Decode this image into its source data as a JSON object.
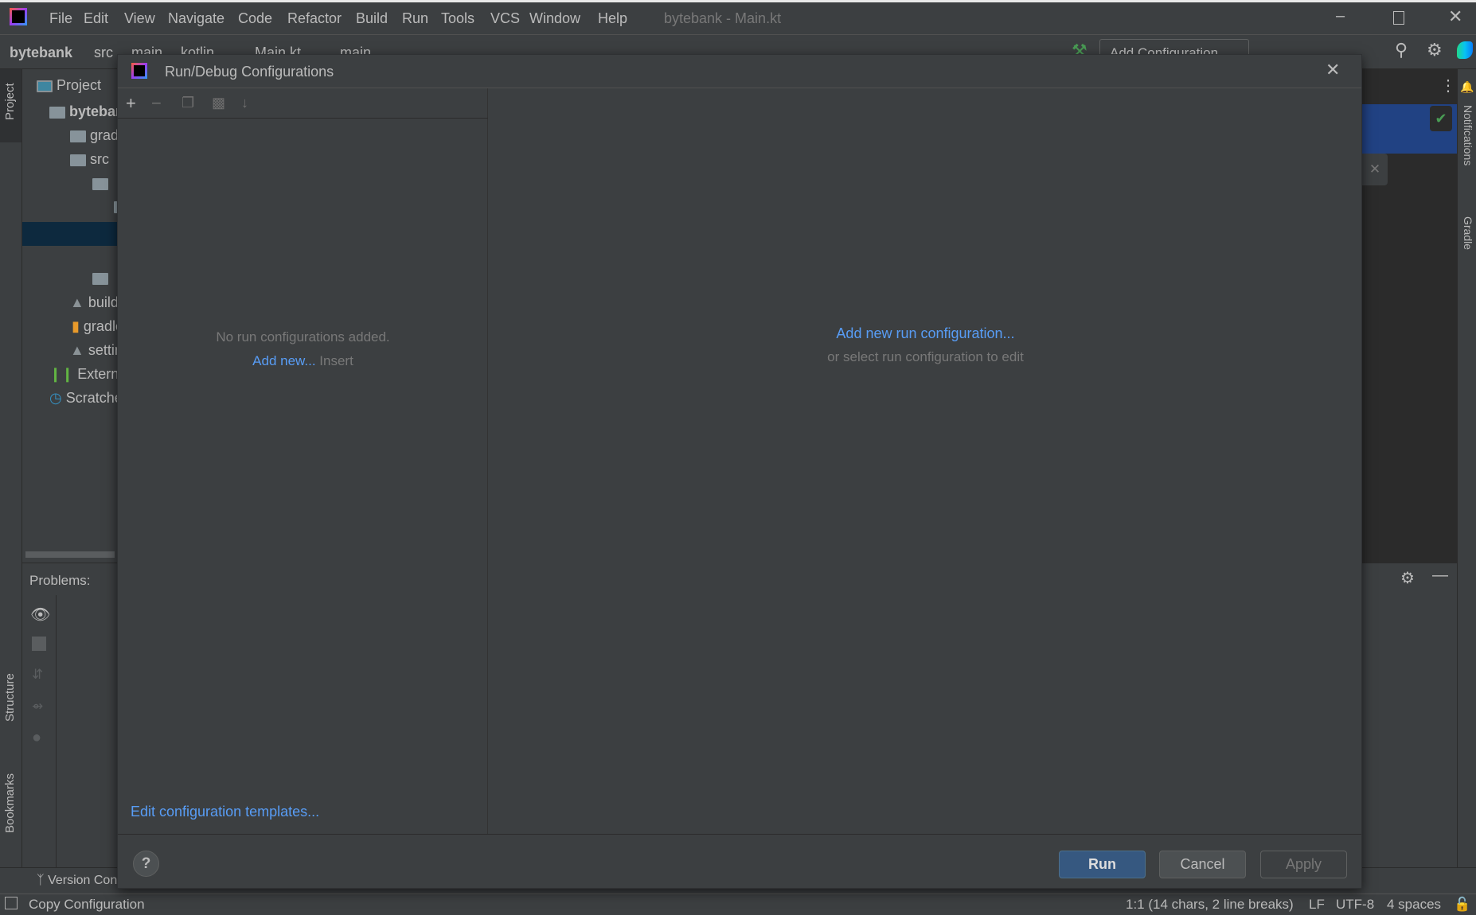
{
  "window": {
    "title": "bytebank - Main.kt",
    "controls": {
      "minimize": "minimize-icon",
      "maximize": "maximize-icon",
      "close": "close-icon"
    }
  },
  "menu": [
    "File",
    "Edit",
    "View",
    "Navigate",
    "Code",
    "Refactor",
    "Build",
    "Run",
    "Tools",
    "VCS",
    "Window",
    "Help"
  ],
  "breadcrumb": [
    "bytebank",
    "src",
    "main",
    "kotlin",
    "Main.kt",
    "main"
  ],
  "toolbar": {
    "add_configuration": "Add Configuration..."
  },
  "left_strip": {
    "project": "Project",
    "structure": "Structure",
    "bookmarks": "Bookmarks"
  },
  "project_panel": {
    "title": "Project",
    "items": [
      {
        "label": "bytebank",
        "icon": "module-folder-icon"
      },
      {
        "label": "gradle",
        "icon": "folder-icon"
      },
      {
        "label": "src",
        "icon": "folder-icon"
      },
      {
        "label": "",
        "icon": "folder-icon"
      },
      {
        "label": "",
        "icon": "folder-icon"
      },
      {
        "label": "",
        "icon": "file-icon"
      },
      {
        "label": "",
        "icon": "file-icon"
      },
      {
        "label": "",
        "icon": "folder-icon"
      },
      {
        "label": "build.gradle.kts",
        "icon": "gradle-kotlin-icon"
      },
      {
        "label": "gradle.properties",
        "icon": "properties-icon"
      },
      {
        "label": "settings.gradle.kts",
        "icon": "gradle-kotlin-icon"
      },
      {
        "label": "External Libraries",
        "icon": "libraries-icon"
      },
      {
        "label": "Scratches and Consoles",
        "icon": "scratches-icon"
      }
    ]
  },
  "problems": {
    "title": "Problems:"
  },
  "right_strip": {
    "notifications": "Notifications",
    "gradle": "Gradle"
  },
  "version_control": {
    "label": "Version Control"
  },
  "dialog": {
    "title": "Run/Debug Configurations",
    "toolbar": [
      "add-icon",
      "remove-icon",
      "copy-icon",
      "new-folder-icon",
      "sort-icon"
    ],
    "empty_text": "No run configurations added.",
    "add_new_link": "Add new...",
    "add_new_shortcut": "Insert",
    "right_link": "Add new run configuration...",
    "right_hint": "or select run configuration to edit",
    "templates_link": "Edit configuration templates...",
    "buttons": {
      "run": "Run",
      "cancel": "Cancel",
      "apply": "Apply"
    }
  },
  "status": {
    "action": "Copy Configuration",
    "position": "1:1 (14 chars, 2 line breaks)",
    "line_sep": "LF",
    "encoding": "UTF-8",
    "indent": "4 spaces"
  },
  "colors": {
    "accent": "#589df6",
    "primary_button": "#365880",
    "selection": "#0d293e"
  }
}
